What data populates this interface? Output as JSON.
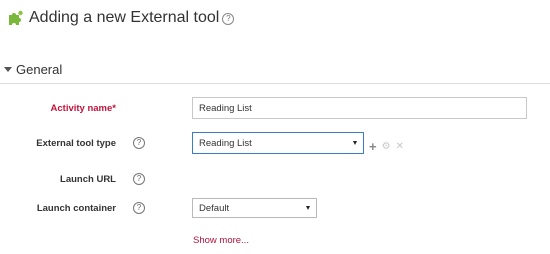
{
  "page": {
    "title": "Adding a new External tool"
  },
  "section": {
    "title": "General"
  },
  "form": {
    "activity_name": {
      "label": "Activity name*",
      "value": "Reading List"
    },
    "external_tool_type": {
      "label": "External tool type",
      "selected": "Reading List"
    },
    "launch_url": {
      "label": "Launch URL"
    },
    "launch_container": {
      "label": "Launch container",
      "selected": "Default"
    },
    "show_more": "Show more..."
  },
  "colors": {
    "required": "#c0143c",
    "link": "#b3123e",
    "focus_border": "#3a7fc5",
    "puzzle": "#7ab83a"
  }
}
